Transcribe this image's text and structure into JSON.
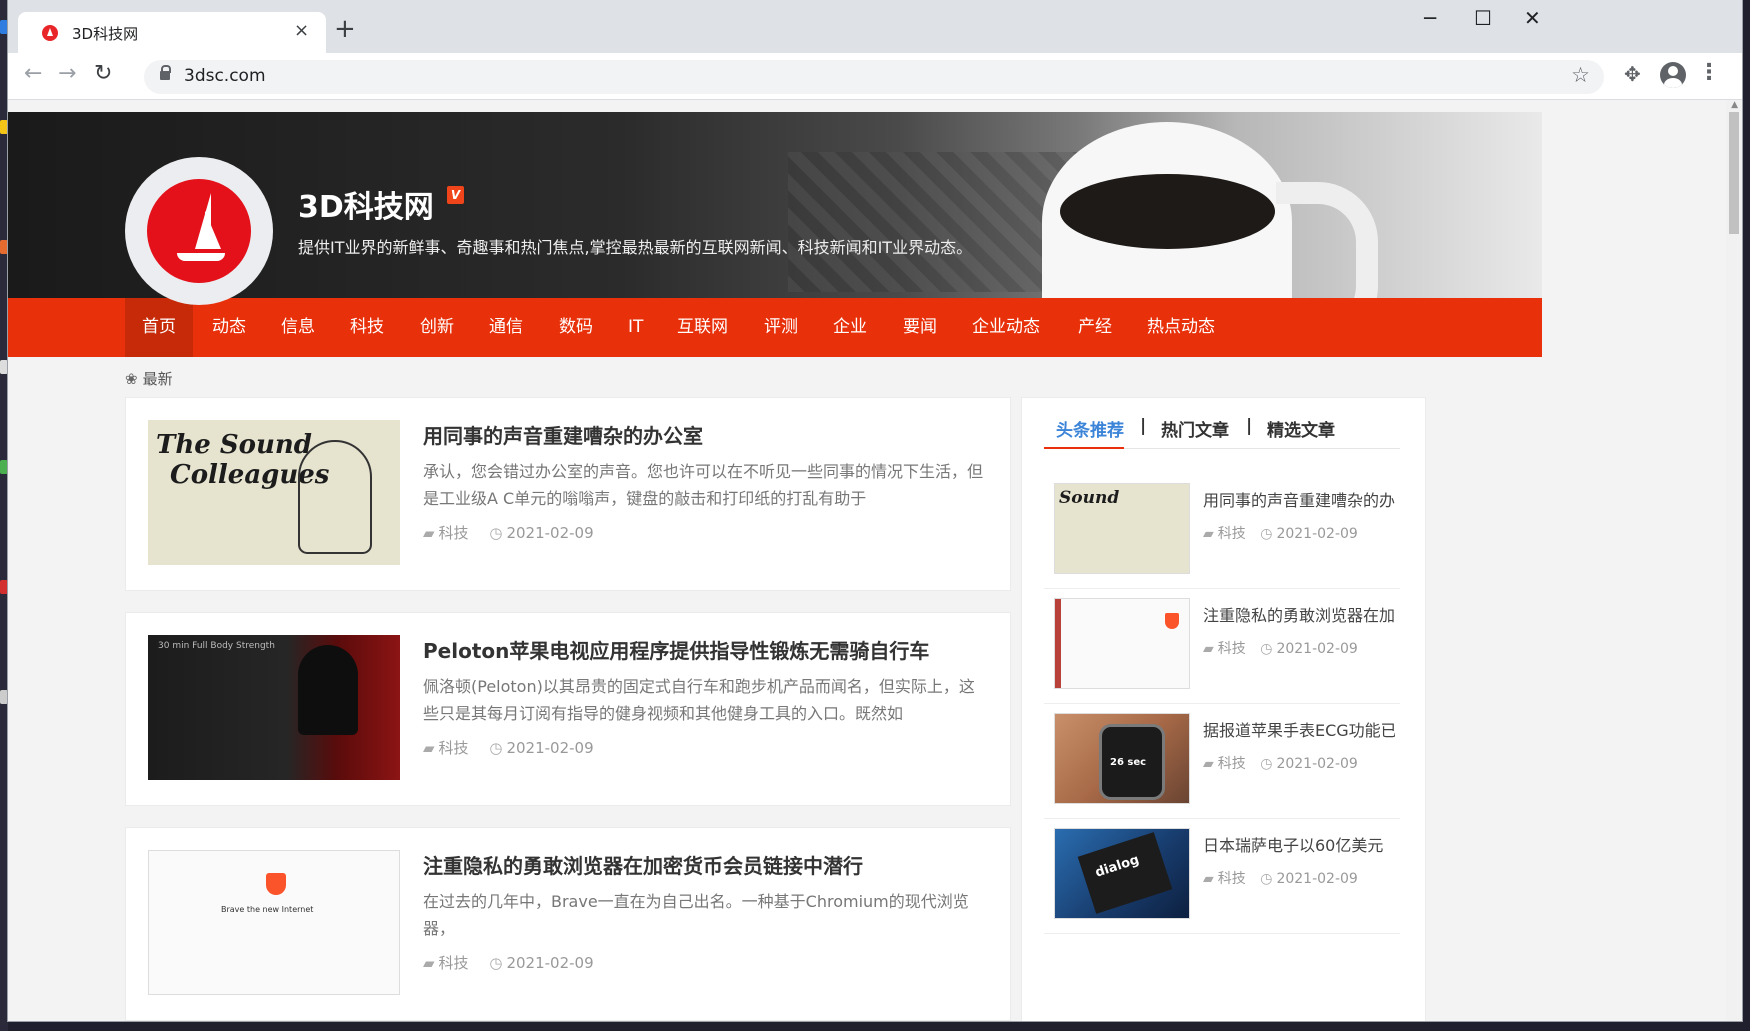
{
  "browser": {
    "tab_title": "3D科技网",
    "tab_close": "×",
    "new_tab": "+",
    "url": "3dsc.com",
    "controls": {
      "minimize": "─",
      "maximize": "☐",
      "close": "✕"
    }
  },
  "site": {
    "name": "3D科技网",
    "badge": "V",
    "description": "提供IT业界的新鲜事、奇趣事和热门焦点,掌控最热最新的互联网新闻、科技新闻和IT业界动态。"
  },
  "nav": [
    "首页",
    "动态",
    "信息",
    "科技",
    "创新",
    "通信",
    "数码",
    "IT",
    "互联网",
    "评测",
    "企业",
    "要闻",
    "企业动态",
    "产经",
    "热点动态"
  ],
  "section_label": "最新",
  "articles": [
    {
      "title": "用同事的声音重建嘈杂的办公室",
      "excerpt": "承认，您会错过办公室的声音。您也许可以在不听见一些同事的情况下生活，但是工业级A C单元的嗡嗡声，键盘的敲击和打印纸的打乱有助于",
      "category": "科技",
      "date": "2021-02-09",
      "thumb_text_1": "The Sound",
      "thumb_text_2": "Colleagues"
    },
    {
      "title": "Peloton苹果电视应用程序提供指导性锻炼无需骑自行车",
      "excerpt": "佩洛顿(Peloton)以其昂贵的固定式自行车和跑步机产品而闻名，但实际上，这些只是其每月订阅有指导的健身视频和其他健身工具的入口。既然如",
      "category": "科技",
      "date": "2021-02-09",
      "thumb_text_1": "30 min Full Body Strength"
    },
    {
      "title": "注重隐私的勇敢浏览器在加密货币会员链接中潜行",
      "excerpt": "在过去的几年中，Brave一直在为自己出名。一种基于Chromium的现代浏览器，",
      "category": "科技",
      "date": "2021-02-09",
      "thumb_text_1": "Brave the new Internet"
    }
  ],
  "sidebar": {
    "tabs": [
      "头条推荐",
      "热门文章",
      "精选文章"
    ],
    "separator": "|",
    "items": [
      {
        "title": "用同事的声音重建嘈杂的办公室",
        "category": "科技",
        "date": "2021-02-09",
        "thumb_text": "Sound"
      },
      {
        "title": "注重隐私的勇敢浏览器在加密货币会员链接中潜行",
        "category": "科技",
        "date": "2021-02-09"
      },
      {
        "title": "据报道苹果手表ECG功能已",
        "category": "科技",
        "date": "2021-02-09",
        "thumb_text": "26 sec"
      },
      {
        "title": "日本瑞萨电子以60亿美元",
        "category": "科技",
        "date": "2021-02-09",
        "thumb_text": "dialog"
      }
    ]
  },
  "colors": {
    "nav_bg": "#e8300a",
    "accent_blue": "#3b84d8",
    "logo_red": "#e4101a"
  }
}
